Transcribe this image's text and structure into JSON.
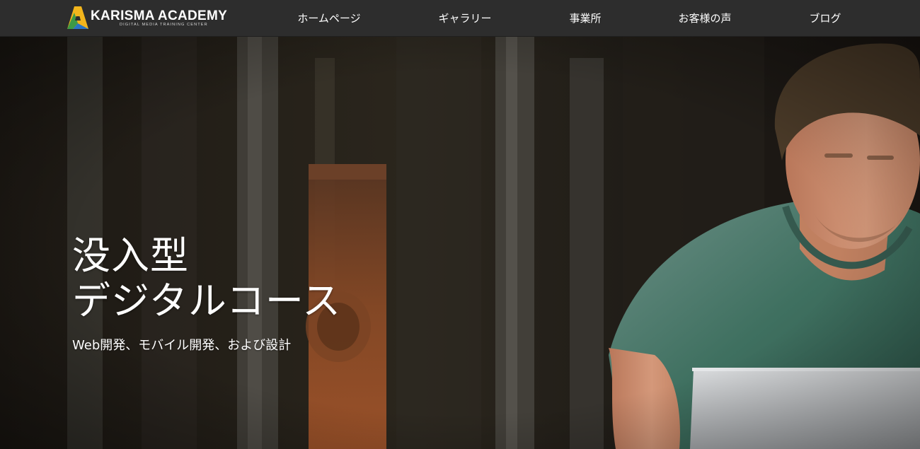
{
  "brand": {
    "name": "KARISMA ACADEMY",
    "tagline": "DIGITAL MEDIA TRAINING CENTER",
    "colors": {
      "yellow": "#f2b51c",
      "green": "#3d9a46",
      "blue": "#2a74c4"
    }
  },
  "nav": {
    "items": [
      {
        "label": "ホームページ"
      },
      {
        "label": "ギャラリー"
      },
      {
        "label": "事業所"
      },
      {
        "label": "お客様の声"
      },
      {
        "label": "ブログ"
      }
    ],
    "background": "#2d2d2d"
  },
  "hero": {
    "title_line1": "没入型",
    "title_line2": "デジタルコース",
    "subtitle": "Web開発、モバイル開発、および設計"
  }
}
